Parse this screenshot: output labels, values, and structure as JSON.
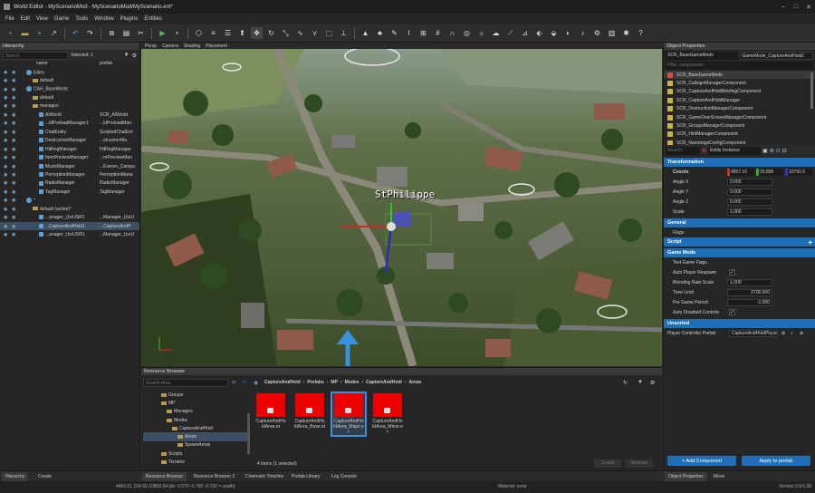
{
  "window": {
    "title": "World Editor - MyScenarioMod - MyScenarioMod/MyScenario.ent*",
    "controls": [
      "–",
      "□",
      "✕"
    ]
  },
  "menu": [
    "File",
    "Edit",
    "View",
    "Game",
    "Tools",
    "Window",
    "Plugins",
    "Entities"
  ],
  "hierarchy": {
    "title": "Hierarchy",
    "search_placeholder": "Search",
    "selected_text": "Selected: 1",
    "col_name": "name",
    "col_prefab": "prefab",
    "rows": [
      {
        "name": "Eden",
        "cls": "",
        "indent": 1,
        "kind": "globe"
      },
      {
        "name": "default",
        "cls": "",
        "indent": 2,
        "kind": "fold"
      },
      {
        "name": "CAH_BaseWorld",
        "cls": "",
        "indent": 1,
        "kind": "globe"
      },
      {
        "name": "default",
        "cls": "",
        "indent": 2,
        "kind": "fold"
      },
      {
        "name": "manages",
        "cls": "",
        "indent": 2,
        "kind": "fold"
      },
      {
        "name": "AIWorld",
        "cls": "SCR_AIWorld",
        "indent": 3,
        "kind": "ent"
      },
      {
        "name": "...ldPreloadManager1",
        "cls": "...ldPreloadMan",
        "indent": 3,
        "kind": "ent"
      },
      {
        "name": "ChatEntity",
        "cls": "ScriptedChatEnt",
        "indent": 3,
        "kind": "ent"
      },
      {
        "name": "DestructionManager",
        "cls": "...structionMa",
        "indent": 3,
        "kind": "ent"
      },
      {
        "name": "HitRegManager",
        "cls": "HitRegManager",
        "indent": 3,
        "kind": "ent"
      },
      {
        "name": "ItemPreviewManager",
        "cls": "...mPreviewMan",
        "indent": 3,
        "kind": "ent"
      },
      {
        "name": "MusicManager",
        "cls": "...Everon_Campa",
        "indent": 3,
        "kind": "ent"
      },
      {
        "name": "PerceptionManager",
        "cls": "PerceptionMana",
        "indent": 3,
        "kind": "ent"
      },
      {
        "name": "RadioManager",
        "cls": "RadioManager",
        "indent": 3,
        "kind": "ent"
      },
      {
        "name": "TagManager",
        "cls": "TagManager",
        "indent": 3,
        "kind": "ent"
      },
      {
        "name": "*",
        "cls": "",
        "indent": 1,
        "kind": "globe"
      },
      {
        "name": "default (active)*",
        "cls": "",
        "indent": 2,
        "kind": "fold"
      },
      {
        "name": "...anager_UsrUSR1",
        "cls": "...Manager_UsrU",
        "indent": 3,
        "kind": "ent"
      },
      {
        "name": "...CaptureAndHold1",
        "cls": "...CaptureAndH",
        "indent": 3,
        "kind": "ent",
        "selected": true
      },
      {
        "name": "...anager_UsrUSR1",
        "cls": "...Manager_UsrU",
        "indent": 3,
        "kind": "ent"
      }
    ]
  },
  "viewport": {
    "tabs": [
      "Persp",
      "Camera",
      "Shading",
      "Placement"
    ],
    "label": "StPhilippe"
  },
  "resource_browser": {
    "title": "Resource Browser",
    "search_placeholder": "Search Area",
    "breadcrumb": [
      "CaptureAndHold",
      "Prefabs",
      "MP",
      "Modes",
      "CaptureAndHold",
      "Areas"
    ],
    "tree": [
      {
        "label": "Groups",
        "indent": 1
      },
      {
        "label": "MP",
        "indent": 1
      },
      {
        "label": "Manages",
        "indent": 2
      },
      {
        "label": "Modes",
        "indent": 2
      },
      {
        "label": "CaptureAndHold",
        "indent": 3
      },
      {
        "label": "Areas",
        "indent": 4,
        "selected": true
      },
      {
        "label": "SpawnAreas",
        "indent": 4
      },
      {
        "label": "Scripts",
        "indent": 1
      },
      {
        "label": "Terrains",
        "indent": 1
      }
    ],
    "files": [
      {
        "name": "CaptureAndHoldArea.et",
        "line1": "CaptureAndHo",
        "line2": "ldArea.et"
      },
      {
        "name": "CaptureAndHoldArea_Base.et",
        "line1": "CaptureAndHo",
        "line2": "ldArea_Base.et"
      },
      {
        "name": "CaptureAndHoldArea_Major.et",
        "line1": "CaptureAndHo",
        "line2": "ldArea_Major.e",
        "line3": "t",
        "selected": true
      },
      {
        "name": "CaptureAndHoldArea_Minor.et",
        "line1": "CaptureAndHo",
        "line2": "ldArea_Minor.e",
        "line3": "t"
      }
    ],
    "footer": "4 items (1 selected)",
    "btn_a": "Create",
    "btn_b": "Remove"
  },
  "properties": {
    "title": "Object Properties",
    "class_name": "SCR_BaseGameMode",
    "entity_name": "GameMode_CaptureAndHold1",
    "filter_placeholder": "Filter components",
    "components": [
      "SCR_BaseGameMode",
      "SCR_CallsignManagerComponent",
      "SCR_CaptureAndHoldBriefingComponent",
      "SCR_CaptureAndHoldManager",
      "SCR_DestructionManagerComponent",
      "SCR_GameOverScreenManagerComponent",
      "SCR_GroupsManagerComponent",
      "SCR_HintManagerComponent",
      "SCR_NametagsConfigComponent"
    ],
    "search_placeholder": "Search",
    "entity_instance_label": "Entity Instance",
    "sections": {
      "transformation": "Transformation",
      "general": "General",
      "script": "Script",
      "game_mode": "Game Mode",
      "unsorted": "Unsorted"
    },
    "coords_label": "Coords",
    "coords": [
      "4507.16",
      "20.895",
      "10791.6"
    ],
    "angle_x_label": "Angle X",
    "angle_x": "0.000",
    "angle_y_label": "Angle Y",
    "angle_y": "0.000",
    "angle_z_label": "Angle Z",
    "angle_z": "0.000",
    "scale_label": "Scale",
    "scale": "1.000",
    "flags_label": "Flags",
    "test_flags_label": "Test Game Flags",
    "auto_respawn_label": "Auto Player Respawn",
    "blend_rate_label": "Blending Rate Scale",
    "blend_rate": "1.000",
    "time_limit_label": "Time Limit",
    "time_limit": "2700.000",
    "pre_period_label": "Pre Game Period",
    "pre_period": "-1.000",
    "auto_disabled_label": "Auto Disabled Controls",
    "player_ctrl_label": "Player Controller Prefab",
    "player_ctrl": "CaptureAndHoldPlayer",
    "add_component": "+ Add Component",
    "apply_prefab": "Apply to prefab"
  },
  "bottom_tabs_left": [
    "Hierarchy",
    "Create"
  ],
  "bottom_tabs_mid": [
    "Resource Browser",
    "Resource Browser 2",
    "Cinematic Timeline",
    "Prefab Library",
    "Log Console"
  ],
  "bottom_tabs_right": [
    "Object Properties",
    "Move"
  ],
  "status": {
    "coords": "4460.51    154.69   10809.94 [dir: 0.070 -0.793 -0.702 = south]",
    "material": "Material: none",
    "version": "Version 0.9.5.38"
  },
  "colors": {
    "accent": "#1e6fb8",
    "selection": "#3d4f63",
    "file_thumb": "#e00000",
    "arrow": "#3a8fe0"
  }
}
